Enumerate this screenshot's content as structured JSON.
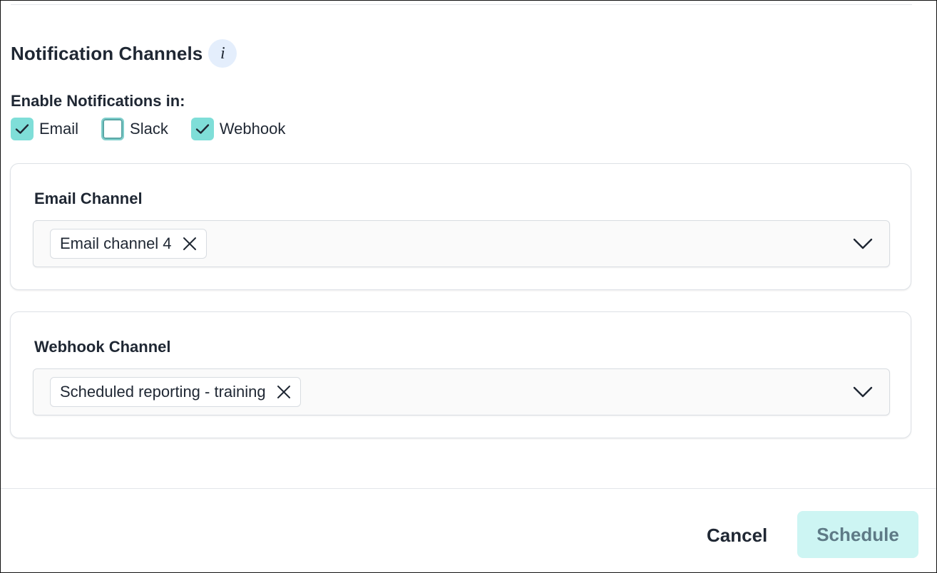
{
  "notification_channels": {
    "title": "Notification Channels",
    "info_icon_text": "i",
    "enable_label": "Enable Notifications in:",
    "channels": [
      {
        "label": "Email",
        "checked": true
      },
      {
        "label": "Slack",
        "checked": false
      },
      {
        "label": "Webhook",
        "checked": true
      }
    ]
  },
  "email_card": {
    "title": "Email Channel",
    "selected": [
      "Email channel 4"
    ]
  },
  "webhook_card": {
    "title": "Webhook Channel",
    "selected": [
      "Scheduled reporting - training"
    ]
  },
  "footer": {
    "cancel_label": "Cancel",
    "schedule_label": "Schedule"
  },
  "colors": {
    "checkbox_checked": "#7fded8",
    "checkbox_focus_ring": "#5ba7a6",
    "schedule_disabled_bg": "#cdf5f3",
    "schedule_disabled_text": "#5e7a86",
    "info_bg": "#e4eefc"
  },
  "icons": {
    "check": "check-icon",
    "remove": "close-icon",
    "dropdown": "chevron-down-icon",
    "info": "info-icon"
  }
}
